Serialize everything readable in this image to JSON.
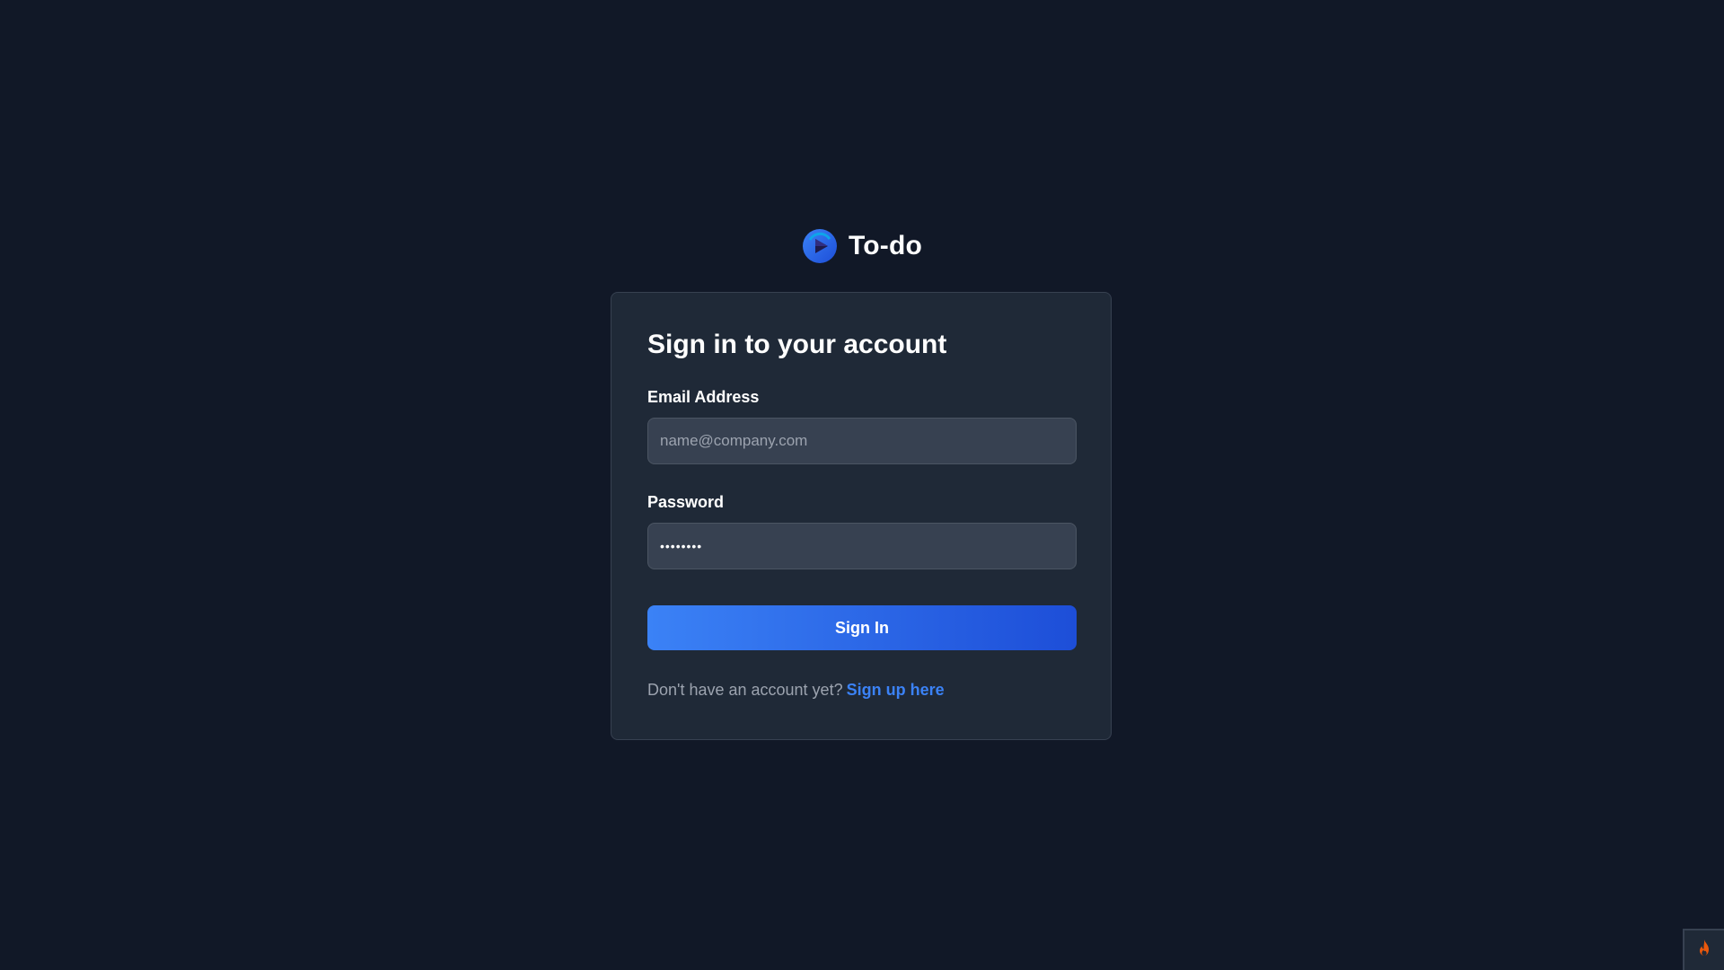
{
  "brand": {
    "name": "To-do",
    "logo_icon": "play-circle-logo-icon",
    "accent": "#2563eb"
  },
  "login": {
    "title": "Sign in to your account",
    "email": {
      "label": "Email Address",
      "placeholder": "name@company.com",
      "value": ""
    },
    "password": {
      "label": "Password",
      "value": "••••••••"
    },
    "submit_label": "Sign In",
    "signup_prompt": "Don't have an account yet?",
    "signup_link": "Sign up here"
  },
  "corner_widget": {
    "icon": "flame-icon",
    "color": "#f97316"
  },
  "colors": {
    "background": "#111827",
    "card": "#1f2937",
    "input": "#374151",
    "link": "#3b82f6"
  }
}
